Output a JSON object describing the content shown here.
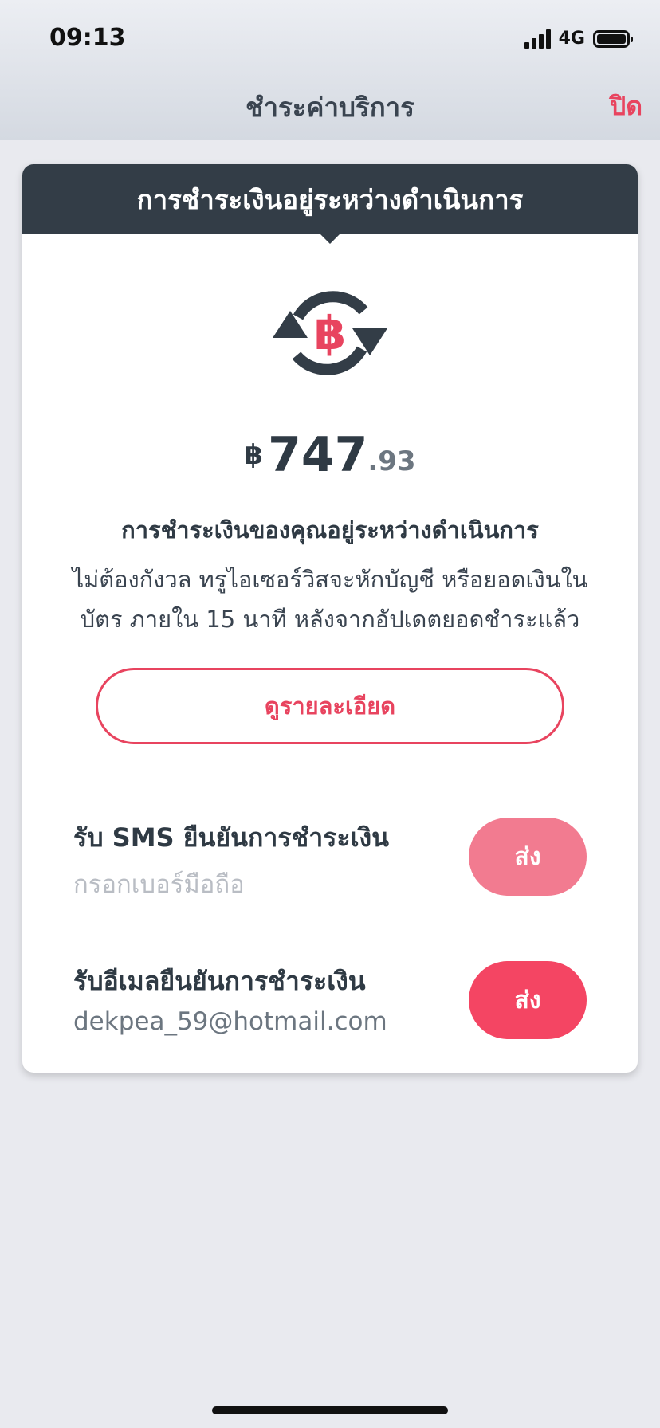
{
  "status": {
    "time": "09:13",
    "network": "4G"
  },
  "nav": {
    "title": "ชำระค่าบริการ",
    "close_label": "ปิด"
  },
  "card": {
    "header": "การชำระเงินอยู่ระหว่างดำเนินการ",
    "icon": "baht-sync-icon",
    "amount": {
      "currency": "฿",
      "main": "747",
      "decimal": ".93"
    },
    "message_title": "การชำระเงินของคุณอยู่ระหว่างดำเนินการ",
    "message_body": "ไม่ต้องกังวล ทรูไอเซอร์วิสจะหักบัญชี หรือยอดเงินในบัตร ภายใน 15 นาที หลังจากอัปเดตยอดชำระแล้ว",
    "details_label": "ดูรายละเอียด",
    "sms": {
      "title": "รับ SMS ยืนยันการชำระเงิน",
      "placeholder": "กรอกเบอร์มือถือ",
      "send_label": "ส่ง"
    },
    "email": {
      "title": "รับอีเมลยืนยันการชำระเงิน",
      "value": "dekpea_59@hotmail.com",
      "send_label": "ส่ง"
    }
  },
  "colors": {
    "accent": "#e8445f",
    "accent_disabled": "#f27b90",
    "accent_active": "#f44563",
    "header_dark": "#333d47"
  }
}
